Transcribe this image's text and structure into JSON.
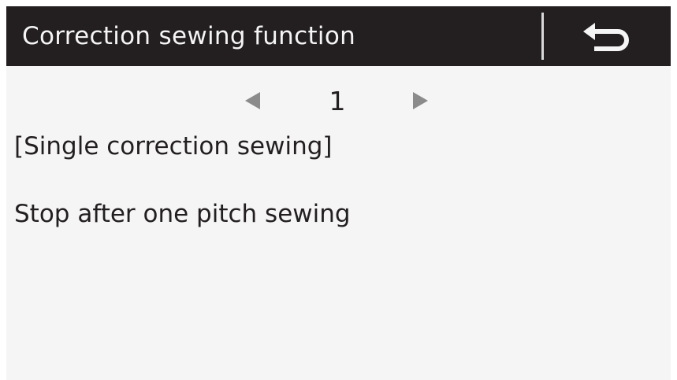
{
  "header": {
    "title": "Correction sewing function",
    "back_icon": "return-arrow-icon"
  },
  "pager": {
    "current_page": "1",
    "prev_icon": "triangle-left-icon",
    "next_icon": "triangle-right-icon"
  },
  "content": {
    "function_name": "[Single correction sewing]",
    "description": "Stop after one pitch sewing"
  },
  "colors": {
    "header_bg": "#231f20",
    "header_text": "#f5f5f5",
    "screen_bg": "#f5f5f5",
    "text": "#231f20",
    "arrow": "#8b8b8b"
  }
}
